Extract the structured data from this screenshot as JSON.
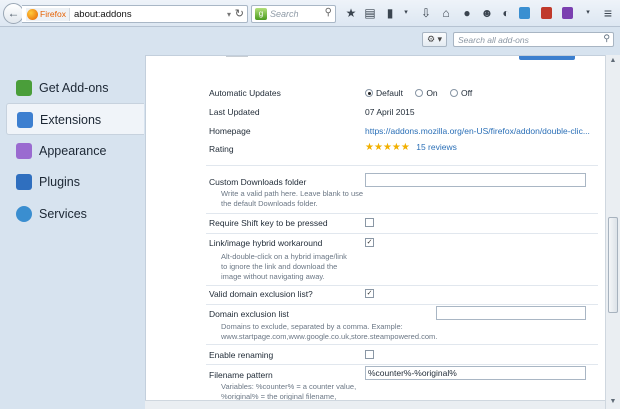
{
  "browser": {
    "identity_label": "Firefox",
    "url": "about:addons",
    "search_placeholder": "Search",
    "toolbar_icons": [
      "bookmark-star-icon",
      "reading-list-icon",
      "bookmarks-menu-icon",
      "download-icon",
      "home-icon",
      "chat-icon",
      "smiley-icon",
      "addon-icon",
      "addon-icon-2",
      "addon-icon-3",
      "hamburger-menu-icon"
    ]
  },
  "sidebar": {
    "items": [
      {
        "label": "Get Add-ons",
        "icon": "get-addons-icon",
        "color": "#4a9e3a",
        "selected": false
      },
      {
        "label": "Extensions",
        "icon": "puzzle-piece-icon",
        "color": "#3d7fd0",
        "selected": true
      },
      {
        "label": "Appearance",
        "icon": "paint-brush-icon",
        "color": "#9a6bd0",
        "selected": false
      },
      {
        "label": "Plugins",
        "icon": "plugin-blocks-icon",
        "color": "#2f6fbf",
        "selected": false
      },
      {
        "label": "Services",
        "icon": "chat-bubbles-icon",
        "color": "#3a8ed0",
        "selected": false
      }
    ]
  },
  "header": {
    "gear_label": "⚙ ▾",
    "search_placeholder": "Search all add-ons"
  },
  "details": {
    "automatic_updates_label": "Automatic Updates",
    "update_options": [
      {
        "label": "Default",
        "selected": true
      },
      {
        "label": "On",
        "selected": false
      },
      {
        "label": "Off",
        "selected": false
      }
    ],
    "last_updated_label": "Last Updated",
    "last_updated_value": "07 April 2015",
    "homepage_label": "Homepage",
    "homepage_value": "https://addons.mozilla.org/en-US/firefox/addon/double-clic...",
    "rating_label": "Rating",
    "rating_stars": 5,
    "reviews_link": "15 reviews"
  },
  "options": {
    "custom_folder_label": "Custom Downloads folder",
    "custom_folder_desc_1": "Write a valid path here. Leave blank to use",
    "custom_folder_desc_2": "the default Downloads folder.",
    "custom_folder_value": "",
    "shift_key_label": "Require Shift key to be pressed",
    "shift_key_checked": false,
    "hybrid_label": "Link/image hybrid workaround",
    "hybrid_checked": true,
    "hybrid_desc_1": "Alt-double-click on a hybrid image/link",
    "hybrid_desc_2": "to ignore the link and download the",
    "hybrid_desc_3": "image without navigating away.",
    "valid_domain_label": "Valid domain exclusion list?",
    "valid_domain_checked": true,
    "domain_list_label": "Domain exclusion list",
    "domain_list_value": "",
    "domain_desc_1": "Domains to exclude, separated by a comma. Example:",
    "domain_desc_2": "www.startpage.com,www.google.co.uk,store.steampowered.com.",
    "renaming_label": "Enable renaming",
    "renaming_checked": false,
    "filename_label": "Filename pattern",
    "filename_value": "%counter%-%original%",
    "filename_desc_1": "Variables: %counter% = a counter value,",
    "filename_desc_2": "%original% = the original filename,"
  }
}
